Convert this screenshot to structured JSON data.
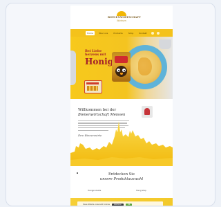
{
  "header": {
    "logo_brand": "BIENENWIRTSCHAFT",
    "logo_sub": "Meissen",
    "nav": [
      "Home",
      "Über uns",
      "Produkte",
      "Shop",
      "Kontakt"
    ]
  },
  "hero": {
    "line1": "Bei Liebe",
    "line2": "herzens mit",
    "line3": "Honig"
  },
  "welcome": {
    "title_line1": "Willkommen bei der",
    "title_line2": "Bienenwirtschaft Meissen",
    "signature": "Ihre Bienenwirte"
  },
  "products": {
    "title_line1": "Entdecken Sie",
    "title_line2": "unsere Produktauswahl",
    "link_left": "Honigprodukte",
    "link_right": "Honig Shop"
  },
  "cookie": {
    "text": "Diese Website verwendet Cookies",
    "decline_label": "Ablehnen",
    "accept_label": "OK"
  },
  "colors": {
    "honey_yellow": "#f4c21b",
    "accent_red": "#a3202a",
    "page_bg": "#eef2f8"
  }
}
